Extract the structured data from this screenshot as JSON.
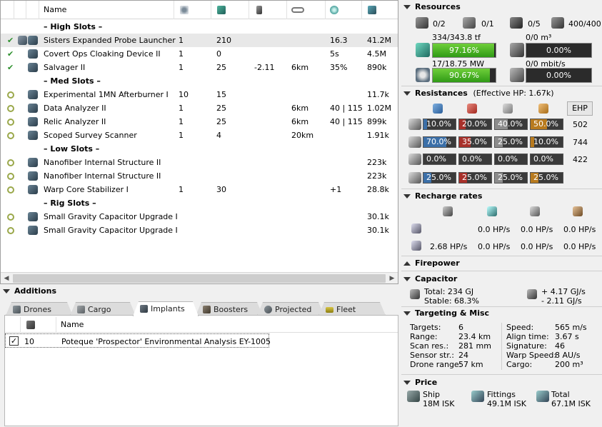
{
  "fit": {
    "headers": {
      "name": "Name"
    },
    "column_icons": [
      "cpu-icon",
      "powergrid-icon",
      "capacitor-use-icon",
      "range-icon",
      "falloff-icon",
      "price-icon"
    ],
    "rows": [
      {
        "type": "slot",
        "name": "– High Slots –"
      },
      {
        "type": "mod",
        "state": "online",
        "name": "Sisters Expanded Probe Launcher",
        "c1": "1",
        "c2": "210",
        "c3": "",
        "c4": "",
        "c5": "16.3",
        "c6": "41.2M",
        "selected": true
      },
      {
        "type": "mod",
        "state": "online",
        "name": "Covert Ops Cloaking Device II",
        "c1": "1",
        "c2": "0",
        "c3": "",
        "c4": "",
        "c5": "5s",
        "c6": "4.5M"
      },
      {
        "type": "mod",
        "state": "online",
        "name": "Salvager II",
        "c1": "1",
        "c2": "25",
        "c3": "-2.11",
        "c4": "6km",
        "c5": "35%",
        "c6": "890k"
      },
      {
        "type": "slot",
        "name": "– Med Slots –"
      },
      {
        "type": "mod",
        "state": "offline",
        "name": "Experimental 1MN Afterburner I",
        "c1": "10",
        "c2": "15",
        "c3": "",
        "c4": "",
        "c5": "",
        "c6": "11.7k"
      },
      {
        "type": "mod",
        "state": "offline",
        "name": "Data Analyzer II",
        "c1": "1",
        "c2": "25",
        "c3": "",
        "c4": "6km",
        "c5": "40 | 115",
        "c6": "1.02M"
      },
      {
        "type": "mod",
        "state": "offline",
        "name": "Relic Analyzer II",
        "c1": "1",
        "c2": "25",
        "c3": "",
        "c4": "6km",
        "c5": "40 | 115",
        "c6": "899k"
      },
      {
        "type": "mod",
        "state": "offline",
        "name": "Scoped Survey Scanner",
        "c1": "1",
        "c2": "4",
        "c3": "",
        "c4": "20km",
        "c5": "",
        "c6": "1.91k"
      },
      {
        "type": "slot",
        "name": "– Low Slots –"
      },
      {
        "type": "mod",
        "state": "offline",
        "name": "Nanofiber Internal Structure II",
        "c1": "",
        "c2": "",
        "c3": "",
        "c4": "",
        "c5": "",
        "c6": "223k"
      },
      {
        "type": "mod",
        "state": "offline",
        "name": "Nanofiber Internal Structure II",
        "c1": "",
        "c2": "",
        "c3": "",
        "c4": "",
        "c5": "",
        "c6": "223k"
      },
      {
        "type": "mod",
        "state": "offline",
        "name": "Warp Core Stabilizer I",
        "c1": "1",
        "c2": "30",
        "c3": "",
        "c4": "",
        "c5": "+1",
        "c6": "28.8k"
      },
      {
        "type": "slot",
        "name": "– Rig Slots –"
      },
      {
        "type": "mod",
        "state": "offline",
        "name": "Small Gravity Capacitor Upgrade I",
        "c1": "",
        "c2": "",
        "c3": "",
        "c4": "",
        "c5": "",
        "c6": "30.1k"
      },
      {
        "type": "mod",
        "state": "offline",
        "name": "Small Gravity Capacitor Upgrade I",
        "c1": "",
        "c2": "",
        "c3": "",
        "c4": "",
        "c5": "",
        "c6": "30.1k"
      }
    ]
  },
  "additions": {
    "title": "Additions",
    "tabs": [
      "Drones",
      "Cargo",
      "Implants",
      "Boosters",
      "Projected",
      "Fleet"
    ],
    "active_tab": "Implants",
    "implants": {
      "header_name": "Name",
      "rows": [
        {
          "checked": true,
          "slot": "10",
          "name": "Poteque 'Prospector' Environmental Analysis EY-1005"
        }
      ]
    }
  },
  "resources": {
    "title": "Resources",
    "counts": [
      {
        "icon": "turret-hardpoint-icon",
        "value": "0/2"
      },
      {
        "icon": "launcher-hardpoint-icon",
        "value": "0/1"
      },
      {
        "icon": "drone-icon",
        "value": "0/5"
      },
      {
        "icon": "drone-bandwidth-icon",
        "value": "400/400"
      }
    ],
    "cpu": {
      "label": "334/343.8 tf",
      "percent_text": "97.16%",
      "fill": 97.16
    },
    "powergrid": {
      "label": "17/18.75 MW",
      "percent_text": "90.67%",
      "fill": 90.67
    },
    "drone_bay": {
      "label": "0/0 m³",
      "percent_text": "0.00%",
      "fill": 0
    },
    "drone_bw": {
      "label": "0/0 mbit/s",
      "percent_text": "0.00%",
      "fill": 0
    }
  },
  "resistances": {
    "title": "Resistances",
    "ehp_text": "(Effective HP: 1.67k)",
    "ehp_button": "EHP",
    "colors": {
      "em": "#3b6fa8",
      "thermal": "#a8302a",
      "kinetic": "#8c8c8c",
      "explosive": "#b87a1e"
    },
    "layers": [
      {
        "name": "shield",
        "values": [
          "10.0%",
          "20.0%",
          "40.0%",
          "50.0%"
        ],
        "fills": [
          10,
          20,
          40,
          50
        ],
        "hp": "502"
      },
      {
        "name": "armor",
        "values": [
          "70.0%",
          "35.0%",
          "25.0%",
          "10.0%"
        ],
        "fills": [
          70,
          35,
          25,
          10
        ],
        "hp": "744"
      },
      {
        "name": "hull",
        "values": [
          "0.0%",
          "0.0%",
          "0.0%",
          "0.0%"
        ],
        "fills": [
          0,
          0,
          0,
          0
        ],
        "hp": "422"
      },
      {
        "name": "damage-pattern",
        "values": [
          "25.0%",
          "25.0%",
          "25.0%",
          "25.0%"
        ],
        "fills": [
          25,
          25,
          25,
          25
        ],
        "hp": ""
      }
    ]
  },
  "recharge": {
    "title": "Recharge rates",
    "rows": [
      {
        "label": "",
        "values": [
          "0.0 HP/s",
          "0.0 HP/s",
          "0.0 HP/s"
        ]
      },
      {
        "label": "2.68 HP/s",
        "values": [
          "0.0 HP/s",
          "0.0 HP/s",
          "0.0 HP/s"
        ]
      }
    ]
  },
  "firepower": {
    "title": "Firepower"
  },
  "capacitor": {
    "title": "Capacitor",
    "total": "Total: 234 GJ",
    "stable": "Stable: 68.3%",
    "gain": "+ 4.17 GJ/s",
    "loss": "- 2.11 GJ/s"
  },
  "targeting": {
    "title": "Targeting & Misc",
    "left": [
      {
        "k": "Targets:",
        "v": "6"
      },
      {
        "k": "Range:",
        "v": "23.4 km"
      },
      {
        "k": "Scan res.:",
        "v": "281 mm"
      },
      {
        "k": "Sensor str.:",
        "v": "24"
      },
      {
        "k": "Drone range:",
        "v": "57 km"
      }
    ],
    "right": [
      {
        "k": "Speed:",
        "v": "565 m/s"
      },
      {
        "k": "Align time:",
        "v": "3.67 s"
      },
      {
        "k": "Signature:",
        "v": "46"
      },
      {
        "k": "Warp Speed:",
        "v": "8 AU/s"
      },
      {
        "k": "Cargo:",
        "v": "200 m³"
      }
    ]
  },
  "price": {
    "title": "Price",
    "items": [
      {
        "label": "Ship",
        "value": "18M ISK"
      },
      {
        "label": "Fittings",
        "value": "49.1M ISK"
      },
      {
        "label": "Total",
        "value": "67.1M ISK"
      }
    ]
  }
}
